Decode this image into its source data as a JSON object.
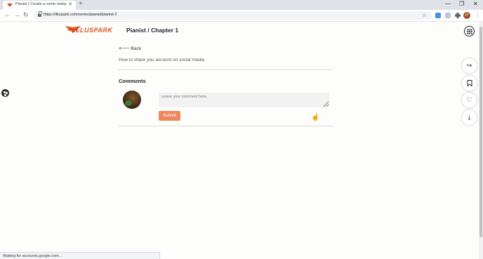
{
  "browser": {
    "tab_title": "Pianist | Create a comic today",
    "tab_close": "✕",
    "new_tab": "+",
    "url": "https://illuspark.com/series/pianist/pianist-2",
    "profile_initial": "P",
    "window_controls": {
      "minimize": "—",
      "restore": "❐",
      "close": "✕"
    },
    "nav": {
      "back": "←",
      "forward": "→",
      "reload": "↻"
    },
    "status_text": "Waiting for accounts.google.com..."
  },
  "site": {
    "logo_text": "ILLUSPARK",
    "brand_color": "#e04e1a",
    "page_title": "Pianist / Chapter 1"
  },
  "content": {
    "back_label": "Back",
    "question": "How to share you account on social media",
    "comments_heading": "Comments",
    "comment_placeholder": "Leave your comment here.",
    "submit_label": "Submit",
    "accent_color": "#f0875c"
  },
  "side_actions": [
    {
      "name": "share-icon",
      "glyph": "↪"
    },
    {
      "name": "bookmark-icon",
      "glyph": "🔖"
    },
    {
      "name": "heart-icon",
      "glyph": "♡"
    },
    {
      "name": "download-icon",
      "glyph": "⤓"
    }
  ]
}
